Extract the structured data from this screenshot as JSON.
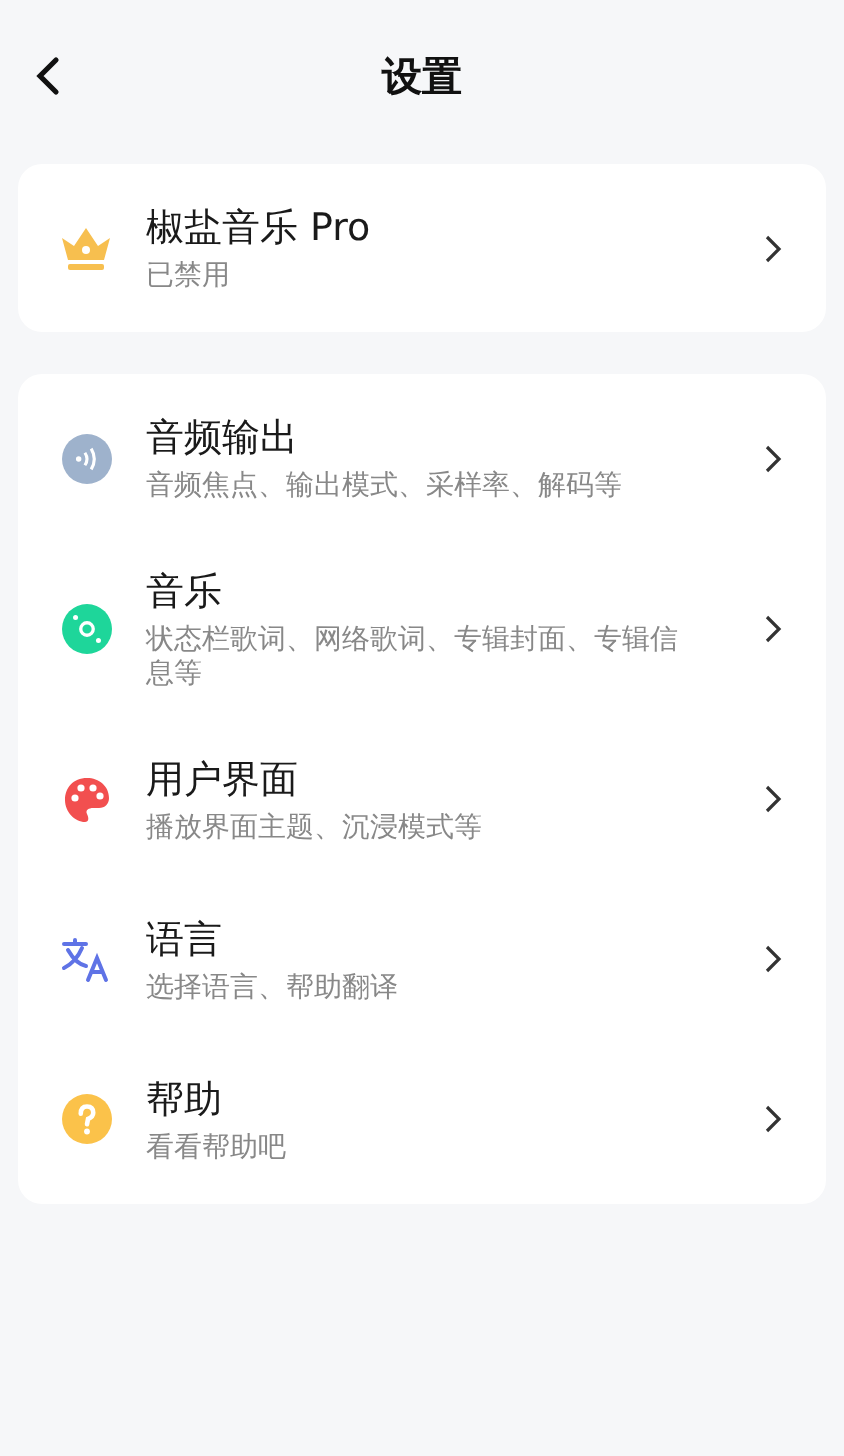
{
  "header": {
    "title": "设置"
  },
  "groups": [
    {
      "items": [
        {
          "kind": "crown",
          "title": "椒盐音乐 Pro",
          "subtitle": "已禁用"
        }
      ]
    },
    {
      "items": [
        {
          "kind": "sound",
          "title": "音频输出",
          "subtitle": "音频焦点、输出模式、采样率、解码等"
        },
        {
          "kind": "disc",
          "title": "音乐",
          "subtitle": "状态栏歌词、网络歌词、专辑封面、专辑信息等"
        },
        {
          "kind": "palette",
          "title": "用户界面",
          "subtitle": "播放界面主题、沉浸模式等"
        },
        {
          "kind": "translate",
          "title": "语言",
          "subtitle": "选择语言、帮助翻译"
        },
        {
          "kind": "help",
          "title": "帮助",
          "subtitle": "看看帮助吧"
        }
      ]
    }
  ]
}
